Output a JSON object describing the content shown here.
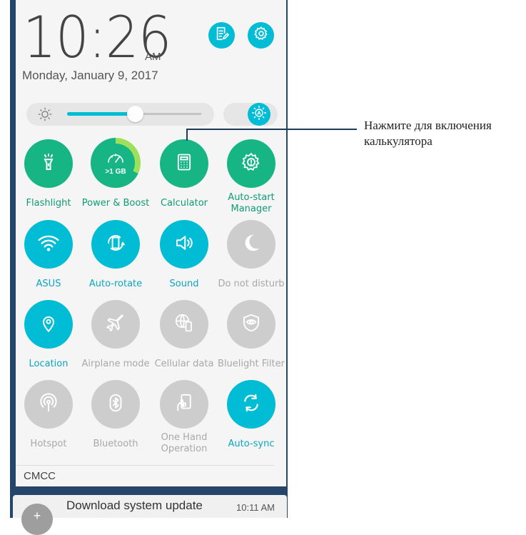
{
  "clock": {
    "time": "10:26",
    "ampm": "AM",
    "date": "Monday, January 9, 2017"
  },
  "header_buttons": [
    {
      "icon": "edit-list-icon"
    },
    {
      "icon": "gear-icon"
    }
  ],
  "brightness": {
    "level": 0.48,
    "auto_icon": "auto-brightness-icon"
  },
  "tiles": [
    {
      "label": "Flashlight",
      "icon": "flashlight-icon",
      "state": "on",
      "color": "#17b584"
    },
    {
      "label": "Power & Boost",
      "icon": "speedometer-icon",
      "state": "on",
      "color": "#17b584",
      "value": ">1 GB"
    },
    {
      "label": "Calculator",
      "icon": "calculator-icon",
      "state": "on",
      "color": "#17b584"
    },
    {
      "label": "Auto-start Manager",
      "icon": "gear-exclamation-icon",
      "state": "on",
      "color": "#17b584"
    },
    {
      "label": "ASUS",
      "icon": "wifi-icon",
      "state": "on",
      "color": "#00bcd4"
    },
    {
      "label": "Auto-rotate",
      "icon": "rotate-icon",
      "state": "on",
      "color": "#00bcd4"
    },
    {
      "label": "Sound",
      "icon": "speaker-icon",
      "state": "on",
      "color": "#00bcd4"
    },
    {
      "label": "Do not disturb",
      "icon": "moon-icon",
      "state": "off"
    },
    {
      "label": "Location",
      "icon": "location-pin-icon",
      "state": "on",
      "color": "#00bcd4"
    },
    {
      "label": "Airplane mode",
      "icon": "airplane-icon",
      "state": "off"
    },
    {
      "label": "Cellular data",
      "icon": "globe-phone-icon",
      "state": "off"
    },
    {
      "label": "Bluelight Filter",
      "icon": "eye-shield-icon",
      "state": "off"
    },
    {
      "label": "Hotspot",
      "icon": "hotspot-icon",
      "state": "off"
    },
    {
      "label": "Bluetooth",
      "icon": "bluetooth-icon",
      "state": "off"
    },
    {
      "label": "One Hand Operation",
      "icon": "one-hand-icon",
      "state": "off"
    },
    {
      "label": "Auto-sync",
      "icon": "sync-icon",
      "state": "on",
      "color": "#00bcd4"
    }
  ],
  "carrier": "CMCC",
  "notification": {
    "title": "Download system update",
    "time": "10:11 AM",
    "avatar": "+"
  },
  "callout": {
    "text": "Нажмите для включения калькулятора"
  }
}
